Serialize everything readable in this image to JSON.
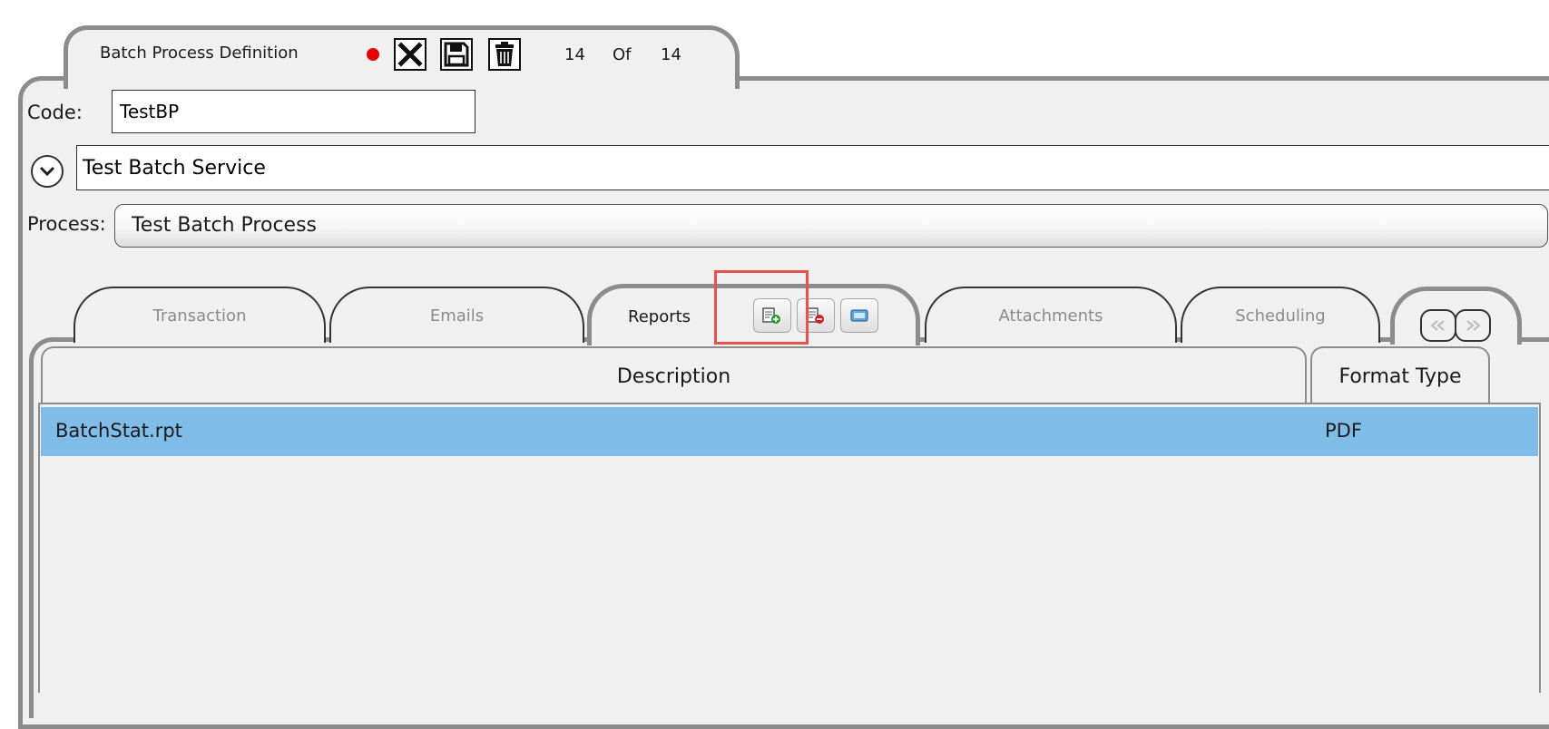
{
  "header": {
    "title": "Batch Process Definition",
    "record_current": "14",
    "record_of": "Of",
    "record_total": "14"
  },
  "form": {
    "code_label": "Code:",
    "code_value": "TestBP",
    "description_value": "Test Batch Service",
    "process_label": "Process:",
    "process_value": "Test Batch Process"
  },
  "tabs": [
    {
      "label": "Transaction"
    },
    {
      "label": "Emails"
    },
    {
      "label": "Reports"
    },
    {
      "label": "Attachments"
    },
    {
      "label": "Scheduling"
    }
  ],
  "grid": {
    "columns": [
      "Description",
      "Format Type"
    ],
    "rows": [
      {
        "description": "BatchStat.rpt",
        "format_type": "PDF",
        "selected": true
      }
    ]
  },
  "icons": {
    "unsaved": "unsaved-dot-icon",
    "cancel": "close-icon",
    "save": "save-icon",
    "delete": "trash-icon",
    "expand": "chevron-down-icon",
    "add_report": "add-report-icon",
    "remove_report": "remove-report-icon",
    "edit_report": "edit-report-icon",
    "nav_prev": "double-left-icon",
    "nav_next": "double-right-icon"
  },
  "colors": {
    "unsaved_indicator": "#e60000",
    "selected_row": "#7fbde8",
    "highlight_outline": "#e5534b",
    "frame_border": "#8c8c8c",
    "panel_background": "#f0f0f0"
  }
}
